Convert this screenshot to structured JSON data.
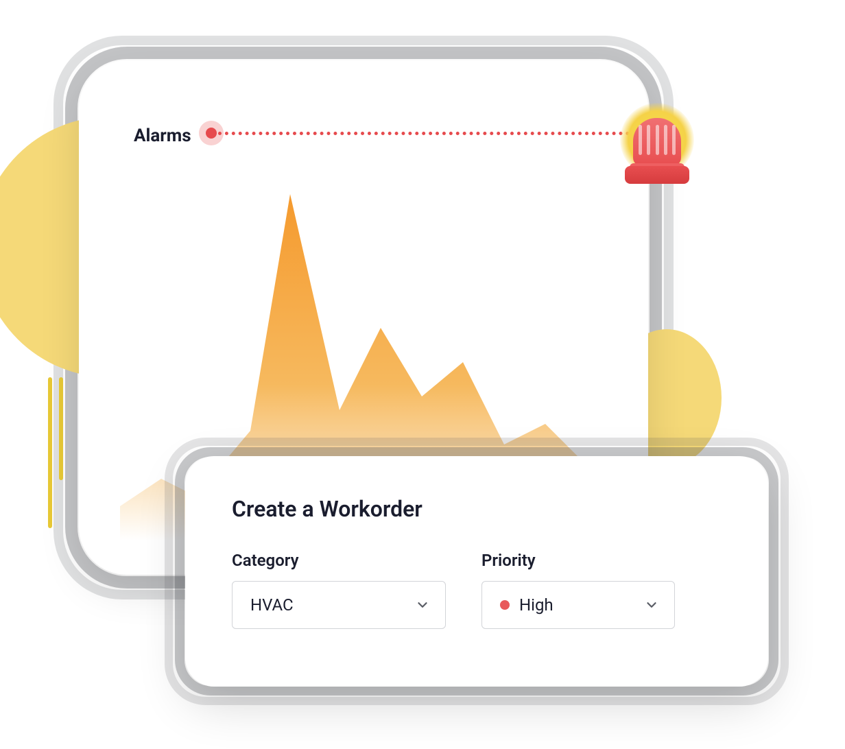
{
  "alarms": {
    "title": "Alarms",
    "icons": {
      "beacon": "alarm-beacon-icon"
    }
  },
  "workorder": {
    "title": "Create a Workorder",
    "fields": {
      "category": {
        "label": "Category",
        "value": "HVAC"
      },
      "priority": {
        "label": "Priority",
        "value": "High",
        "dot_color": "#e8595b"
      }
    }
  },
  "colors": {
    "accent_yellow": "#f5d978",
    "accent_red": "#e64a4d",
    "text_dark": "#1a1d2e"
  },
  "chart_data": {
    "type": "area",
    "title": "Alarms",
    "xlabel": "",
    "ylabel": "",
    "ylim": [
      0,
      100
    ],
    "x": [
      0,
      1,
      2,
      3,
      4,
      5,
      6,
      7,
      8,
      9,
      10,
      11,
      12
    ],
    "values": [
      10,
      18,
      12,
      30,
      100,
      38,
      62,
      40,
      50,
      28,
      34,
      22,
      10
    ],
    "peak": {
      "x": 4,
      "value": 100,
      "label": "alarm-trigger"
    }
  }
}
